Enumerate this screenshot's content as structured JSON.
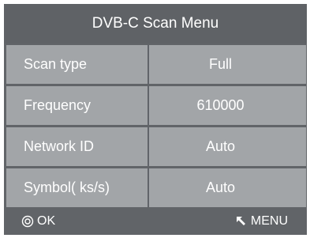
{
  "title": "DVB-C Scan Menu",
  "rows": [
    {
      "label": "Scan type",
      "value": "Full"
    },
    {
      "label": "Frequency",
      "value": "610000"
    },
    {
      "label": "Network ID",
      "value": "Auto"
    },
    {
      "label": "Symbol( ks/s)",
      "value": "Auto"
    }
  ],
  "footer": {
    "ok_label": "OK",
    "ok_icon": "ok-circle-icon",
    "menu_label": "MENU",
    "menu_icon": "return-arrow-icon"
  },
  "colors": {
    "panel_bg": "#616468",
    "row_bg": "#a2a5a8",
    "text": "#ffffff"
  }
}
